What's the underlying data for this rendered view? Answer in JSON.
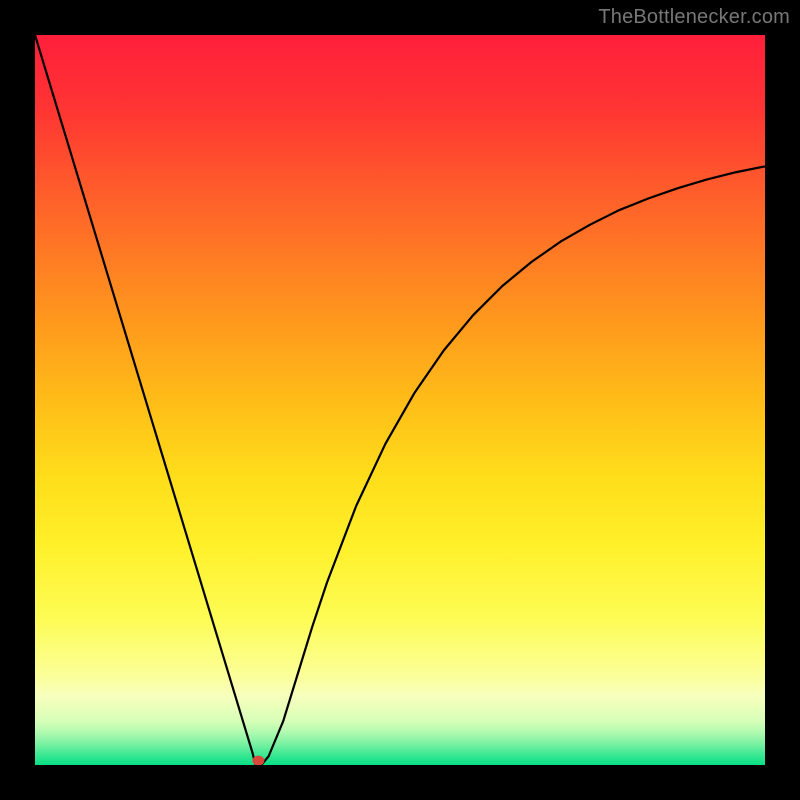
{
  "watermark": "TheBottlenecker.com",
  "chart_data": {
    "type": "line",
    "title": "",
    "xlabel": "",
    "ylabel": "",
    "xlim": [
      0,
      100
    ],
    "ylim": [
      0,
      100
    ],
    "x": [
      0,
      2,
      4,
      6,
      8,
      10,
      12,
      14,
      16,
      18,
      20,
      22,
      24,
      26,
      27.5,
      28.5,
      29.2,
      29.8,
      30.2,
      31,
      32,
      34,
      36,
      38,
      40,
      44,
      48,
      52,
      56,
      60,
      64,
      68,
      72,
      76,
      80,
      84,
      88,
      92,
      96,
      100
    ],
    "y": [
      100,
      93.4,
      86.8,
      80.2,
      73.6,
      67.0,
      60.4,
      53.8,
      47.2,
      40.6,
      34.0,
      27.4,
      20.8,
      14.2,
      9.25,
      5.95,
      3.64,
      1.66,
      0.0,
      0.0,
      1.2,
      6.0,
      12.5,
      19.0,
      25.0,
      35.5,
      44.0,
      51.0,
      56.8,
      61.6,
      65.6,
      68.9,
      71.7,
      74.0,
      76.0,
      77.6,
      79.0,
      80.2,
      81.2,
      82.0
    ],
    "marker": {
      "x": 30.6,
      "y": 0.6
    },
    "gradient_stops": [
      {
        "offset": 0.0,
        "color": "#ff1f3b"
      },
      {
        "offset": 0.1,
        "color": "#ff3433"
      },
      {
        "offset": 0.2,
        "color": "#ff582c"
      },
      {
        "offset": 0.3,
        "color": "#ff7a24"
      },
      {
        "offset": 0.4,
        "color": "#ff9b1c"
      },
      {
        "offset": 0.5,
        "color": "#ffbc18"
      },
      {
        "offset": 0.6,
        "color": "#ffdc1a"
      },
      {
        "offset": 0.7,
        "color": "#fff02a"
      },
      {
        "offset": 0.8,
        "color": "#fdfc55"
      },
      {
        "offset": 0.875,
        "color": "#fbff96"
      },
      {
        "offset": 0.905,
        "color": "#f8ffbc"
      },
      {
        "offset": 0.94,
        "color": "#d7ffb8"
      },
      {
        "offset": 0.955,
        "color": "#b0fab0"
      },
      {
        "offset": 0.97,
        "color": "#7ef2a4"
      },
      {
        "offset": 0.985,
        "color": "#3fe893"
      },
      {
        "offset": 1.0,
        "color": "#07df85"
      }
    ]
  }
}
